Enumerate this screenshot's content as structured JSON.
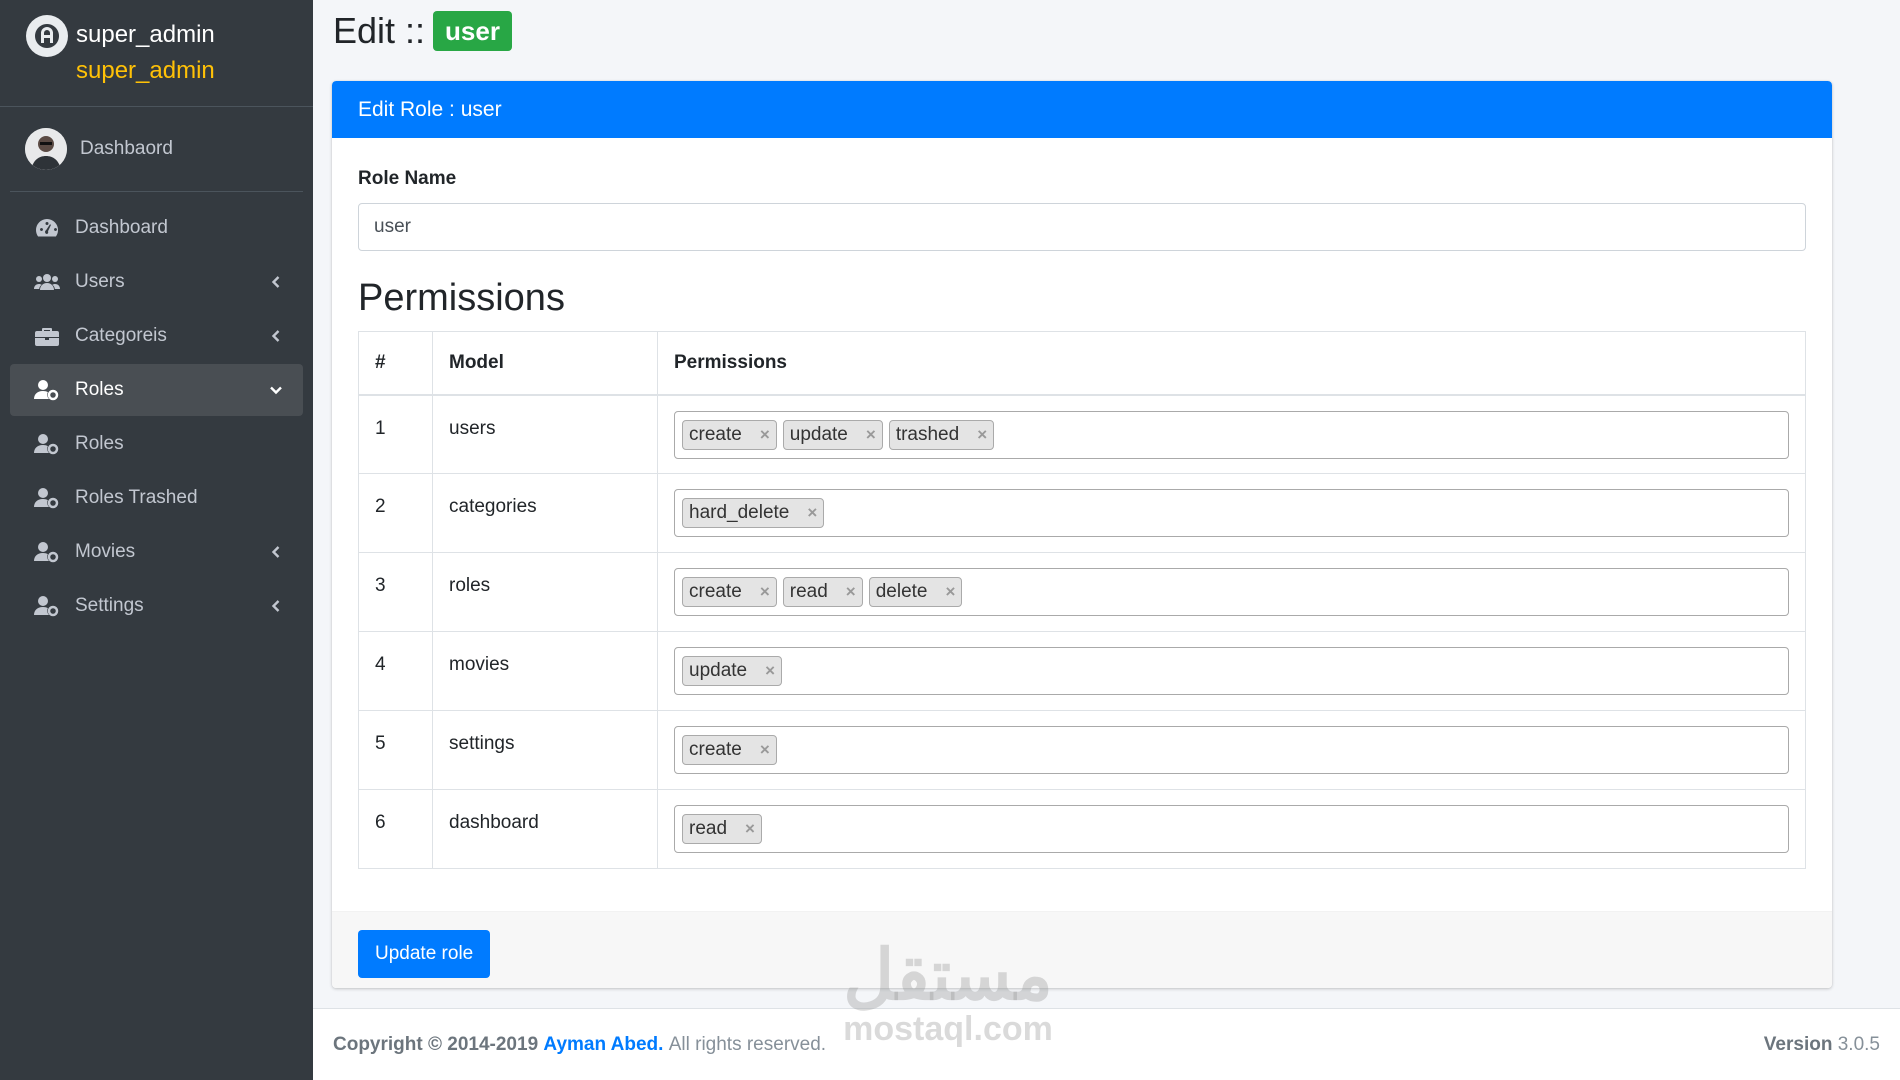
{
  "brand": {
    "name": "super_admin",
    "role": "super_admin"
  },
  "user_panel": {
    "name": "Dashbaord"
  },
  "nav": [
    {
      "label": "Dashboard",
      "icon": "tachometer-icon",
      "chevron": "none",
      "active": false
    },
    {
      "label": "Users",
      "icon": "users-icon",
      "chevron": "left",
      "active": false
    },
    {
      "label": "Categoreis",
      "icon": "briefcase-icon",
      "chevron": "left",
      "active": false
    },
    {
      "label": "Roles",
      "icon": "user-cog-icon",
      "chevron": "down",
      "active": true
    },
    {
      "label": "Roles",
      "icon": "user-cog-icon",
      "chevron": "none",
      "active": false
    },
    {
      "label": "Roles Trashed",
      "icon": "user-cog-icon",
      "chevron": "none",
      "active": false
    },
    {
      "label": "Movies",
      "icon": "user-cog-icon",
      "chevron": "left",
      "active": false
    },
    {
      "label": "Settings",
      "icon": "user-cog-icon",
      "chevron": "left",
      "active": false
    }
  ],
  "page": {
    "title": "Edit ::",
    "badge": "user"
  },
  "card": {
    "header": "Edit Role : user",
    "role_name_label": "Role Name",
    "role_name_value": "user",
    "permissions_title": "Permissions",
    "table": {
      "headers": [
        "#",
        "Model",
        "Permissions"
      ],
      "rows": [
        {
          "num": "1",
          "model": "users",
          "tags": [
            "create",
            "update",
            "trashed"
          ]
        },
        {
          "num": "2",
          "model": "categories",
          "tags": [
            "hard_delete"
          ]
        },
        {
          "num": "3",
          "model": "roles",
          "tags": [
            "create",
            "read",
            "delete"
          ]
        },
        {
          "num": "4",
          "model": "movies",
          "tags": [
            "update"
          ]
        },
        {
          "num": "5",
          "model": "settings",
          "tags": [
            "create"
          ]
        },
        {
          "num": "6",
          "model": "dashboard",
          "tags": [
            "read"
          ]
        }
      ]
    },
    "submit_label": "Update role"
  },
  "footer": {
    "copyright": "Copyright © 2014-2019",
    "author": "Ayman Abed.",
    "rights": "All rights reserved.",
    "version_label": "Version",
    "version": "3.0.5"
  },
  "watermark": {
    "logo": "مستقل",
    "text": "mostaql.com"
  },
  "colors": {
    "sidebar": "#343a40",
    "primary": "#007bff",
    "success": "#28a745",
    "brand_sub": "#ffc107"
  }
}
